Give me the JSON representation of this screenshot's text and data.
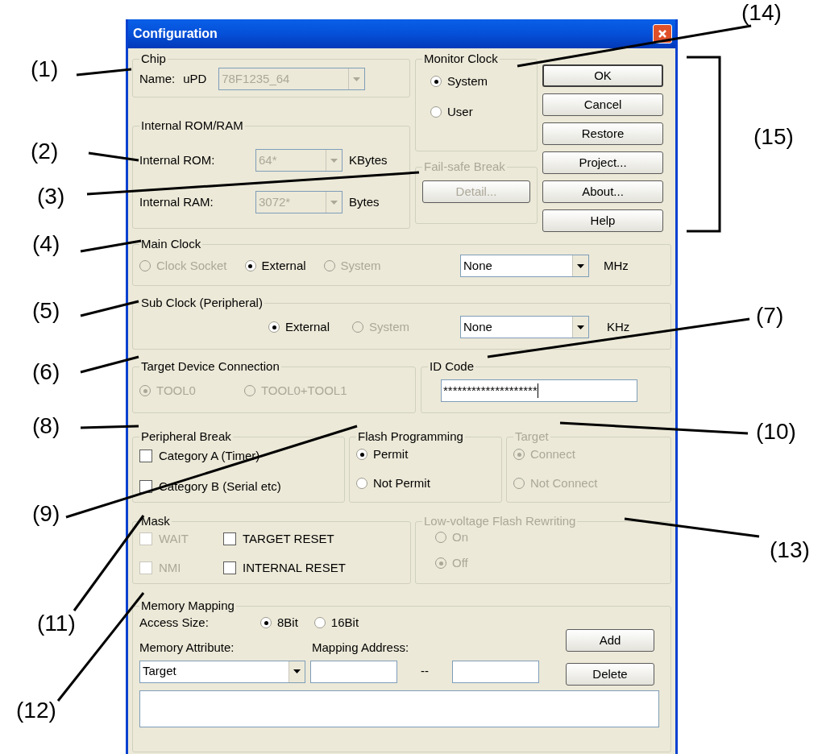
{
  "window": {
    "title": "Configuration"
  },
  "chip": {
    "title": "Chip",
    "name_label": "Name:",
    "prefix": "uPD",
    "value": "78F1235_64",
    "disabled": true
  },
  "internal_rom_ram": {
    "title": "Internal ROM/RAM",
    "rows": [
      {
        "label": "Internal ROM:",
        "value": "64*",
        "unit": "KBytes",
        "disabled": true
      },
      {
        "label": "Internal RAM:",
        "value": "3072*",
        "unit": "Bytes",
        "disabled": true
      }
    ]
  },
  "monitor_clock": {
    "title": "Monitor Clock",
    "options": [
      {
        "label": "System",
        "selected": true,
        "disabled": false
      },
      {
        "label": "User",
        "selected": false,
        "disabled": false
      }
    ]
  },
  "fail_safe_break": {
    "title": "Fail-safe Break",
    "disabled": true,
    "button": "Detail..."
  },
  "buttons": [
    {
      "label": "OK",
      "default": true
    },
    {
      "label": "Cancel",
      "default": false
    },
    {
      "label": "Restore",
      "default": false
    },
    {
      "label": "Project...",
      "default": false
    },
    {
      "label": "About...",
      "default": false
    },
    {
      "label": "Help",
      "default": false
    }
  ],
  "main_clock": {
    "title": "Main Clock",
    "options": [
      {
        "label": "Clock Socket",
        "selected": false,
        "disabled": true
      },
      {
        "label": "External",
        "selected": true,
        "disabled": false
      },
      {
        "label": "System",
        "selected": false,
        "disabled": true
      }
    ],
    "select": "None",
    "unit": "MHz"
  },
  "sub_clock": {
    "title": "Sub Clock (Peripheral)",
    "options": [
      {
        "label": "External",
        "selected": true,
        "disabled": false
      },
      {
        "label": "System",
        "selected": false,
        "disabled": true
      }
    ],
    "select": "None",
    "unit": "KHz"
  },
  "target_device_connection": {
    "title": "Target Device Connection",
    "options": [
      {
        "label": "TOOL0",
        "selected": true,
        "disabled": true
      },
      {
        "label": "TOOL0+TOOL1",
        "selected": false,
        "disabled": true
      }
    ]
  },
  "id_code": {
    "title": "ID Code",
    "value": "********************"
  },
  "peripheral_break": {
    "title": "Peripheral Break",
    "checkboxes": [
      {
        "label": "Category A (Timer)",
        "checked": false,
        "disabled": false
      },
      {
        "label": "Category B (Serial etc)",
        "checked": false,
        "disabled": false
      }
    ]
  },
  "flash_programming": {
    "title": "Flash Programming",
    "options": [
      {
        "label": "Permit",
        "selected": true,
        "disabled": false
      },
      {
        "label": "Not Permit",
        "selected": false,
        "disabled": false
      }
    ]
  },
  "target": {
    "title": "Target",
    "disabled": true,
    "options": [
      {
        "label": "Connect",
        "selected": true,
        "disabled": true
      },
      {
        "label": "Not Connect",
        "selected": false,
        "disabled": true
      }
    ]
  },
  "mask": {
    "title": "Mask",
    "checkboxes": [
      {
        "label": "WAIT",
        "checked": false,
        "disabled": true
      },
      {
        "label": "TARGET RESET",
        "checked": false,
        "disabled": false
      },
      {
        "label": "NMI",
        "checked": false,
        "disabled": true
      },
      {
        "label": "INTERNAL RESET",
        "checked": false,
        "disabled": false
      }
    ]
  },
  "low_voltage_flash_rewriting": {
    "title": "Low-voltage Flash Rewriting",
    "disabled": true,
    "options": [
      {
        "label": "On",
        "selected": false,
        "disabled": true
      },
      {
        "label": "Off",
        "selected": true,
        "disabled": true
      }
    ]
  },
  "memory_mapping": {
    "title": "Memory Mapping",
    "access_size_label": "Access Size:",
    "access_size_options": [
      {
        "label": "8Bit",
        "selected": true,
        "disabled": false
      },
      {
        "label": "16Bit",
        "selected": false,
        "disabled": false
      }
    ],
    "attribute_label": "Memory Attribute:",
    "attribute_value": "Target",
    "address_label": "Mapping Address:",
    "separator": "--",
    "buttons": [
      "Add",
      "Delete"
    ]
  },
  "callouts": [
    {
      "label": "(1)"
    },
    {
      "label": "(2)"
    },
    {
      "label": "(3)"
    },
    {
      "label": "(4)"
    },
    {
      "label": "(5)"
    },
    {
      "label": "(6)"
    },
    {
      "label": "(7)"
    },
    {
      "label": "(8)"
    },
    {
      "label": "(9)"
    },
    {
      "label": "(10)"
    },
    {
      "label": "(11)"
    },
    {
      "label": "(12)"
    },
    {
      "label": "(13)"
    },
    {
      "label": "(14)"
    },
    {
      "label": "(15)"
    }
  ]
}
